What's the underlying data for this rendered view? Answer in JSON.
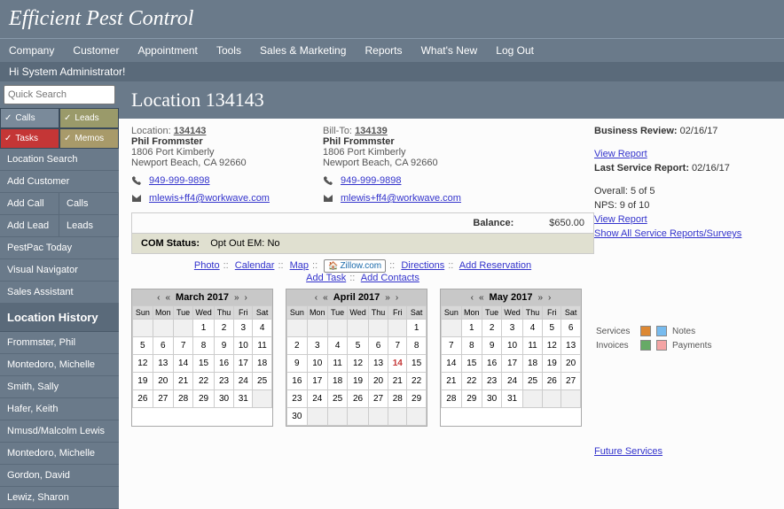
{
  "brand": "Efficient Pest Control",
  "greeting": "Hi System Administrator!",
  "menu": [
    "Company",
    "Customer",
    "Appointment",
    "Tools",
    "Sales & Marketing",
    "Reports",
    "What's New",
    "Log Out"
  ],
  "search_placeholder": "Quick Search",
  "tabs": {
    "calls": "Calls",
    "leads": "Leads",
    "tasks": "Tasks",
    "memos": "Memos"
  },
  "sidebar": {
    "items1": [
      "Location Search",
      "Add Customer"
    ],
    "row1": [
      "Add Call",
      "Calls"
    ],
    "row2": [
      "Add Lead",
      "Leads"
    ],
    "items2": [
      "PestPac Today",
      "Visual Navigator",
      "Sales Assistant"
    ],
    "history_hdr": "Location History",
    "history": [
      "Frommster, Phil",
      "Montedoro, Michelle",
      "Smith, Sally",
      "Hafer, Keith",
      "Nmusd/Malcolm Lewis",
      "Montedoro, Michelle",
      "Gordon, David",
      "Lewiz, Sharon"
    ]
  },
  "page_title": "Location 134143",
  "location": {
    "label": "Location:",
    "id": "134143",
    "name": "Phil Frommster",
    "addr1": "1806 Port Kimberly",
    "addr2": "Newport Beach, CA 92660",
    "phone": "949-999-9898",
    "email": "mlewis+ff4@workwave.com"
  },
  "billto": {
    "label": "Bill-To:",
    "id": "134139",
    "name": "Phil Frommster",
    "addr1": "1806 Port Kimberly",
    "addr2": "Newport Beach, CA 92660",
    "phone": "949-999-9898",
    "email": "mlewis+ff4@workwave.com"
  },
  "balance": {
    "label": "Balance:",
    "value": "$650.00"
  },
  "com": {
    "label": "COM Status:",
    "opt": "Opt Out EM:",
    "val": "No"
  },
  "links": {
    "photo": "Photo",
    "calendar": "Calendar",
    "map": "Map",
    "zillow": "Zillow.com",
    "directions": "Directions",
    "addres": "Add Reservation",
    "addtask": "Add Task",
    "addcontacts": "Add Contacts"
  },
  "calendars": [
    {
      "title": "March 2017",
      "leading_blanks": 3,
      "days": 31,
      "highlight": null
    },
    {
      "title": "April 2017",
      "leading_blanks": 6,
      "days": 30,
      "highlight": 14
    },
    {
      "title": "May 2017",
      "leading_blanks": 1,
      "days": 31,
      "highlight": null
    }
  ],
  "weekdays": [
    "Sun",
    "Mon",
    "Tue",
    "Wed",
    "Thu",
    "Fri",
    "Sat"
  ],
  "legend": {
    "services": "Services",
    "invoices": "Invoices",
    "notes": "Notes",
    "payments": "Payments"
  },
  "future": "Future Services",
  "review": {
    "biz_label": "Business Review:",
    "biz_date": "02/16/17",
    "view": "View Report",
    "last_label": "Last Service Report:",
    "last_date": "02/16/17",
    "overall": "Overall: 5 of 5",
    "nps": "NPS: 9 of 10",
    "showall": "Show All Service Reports/Surveys"
  }
}
